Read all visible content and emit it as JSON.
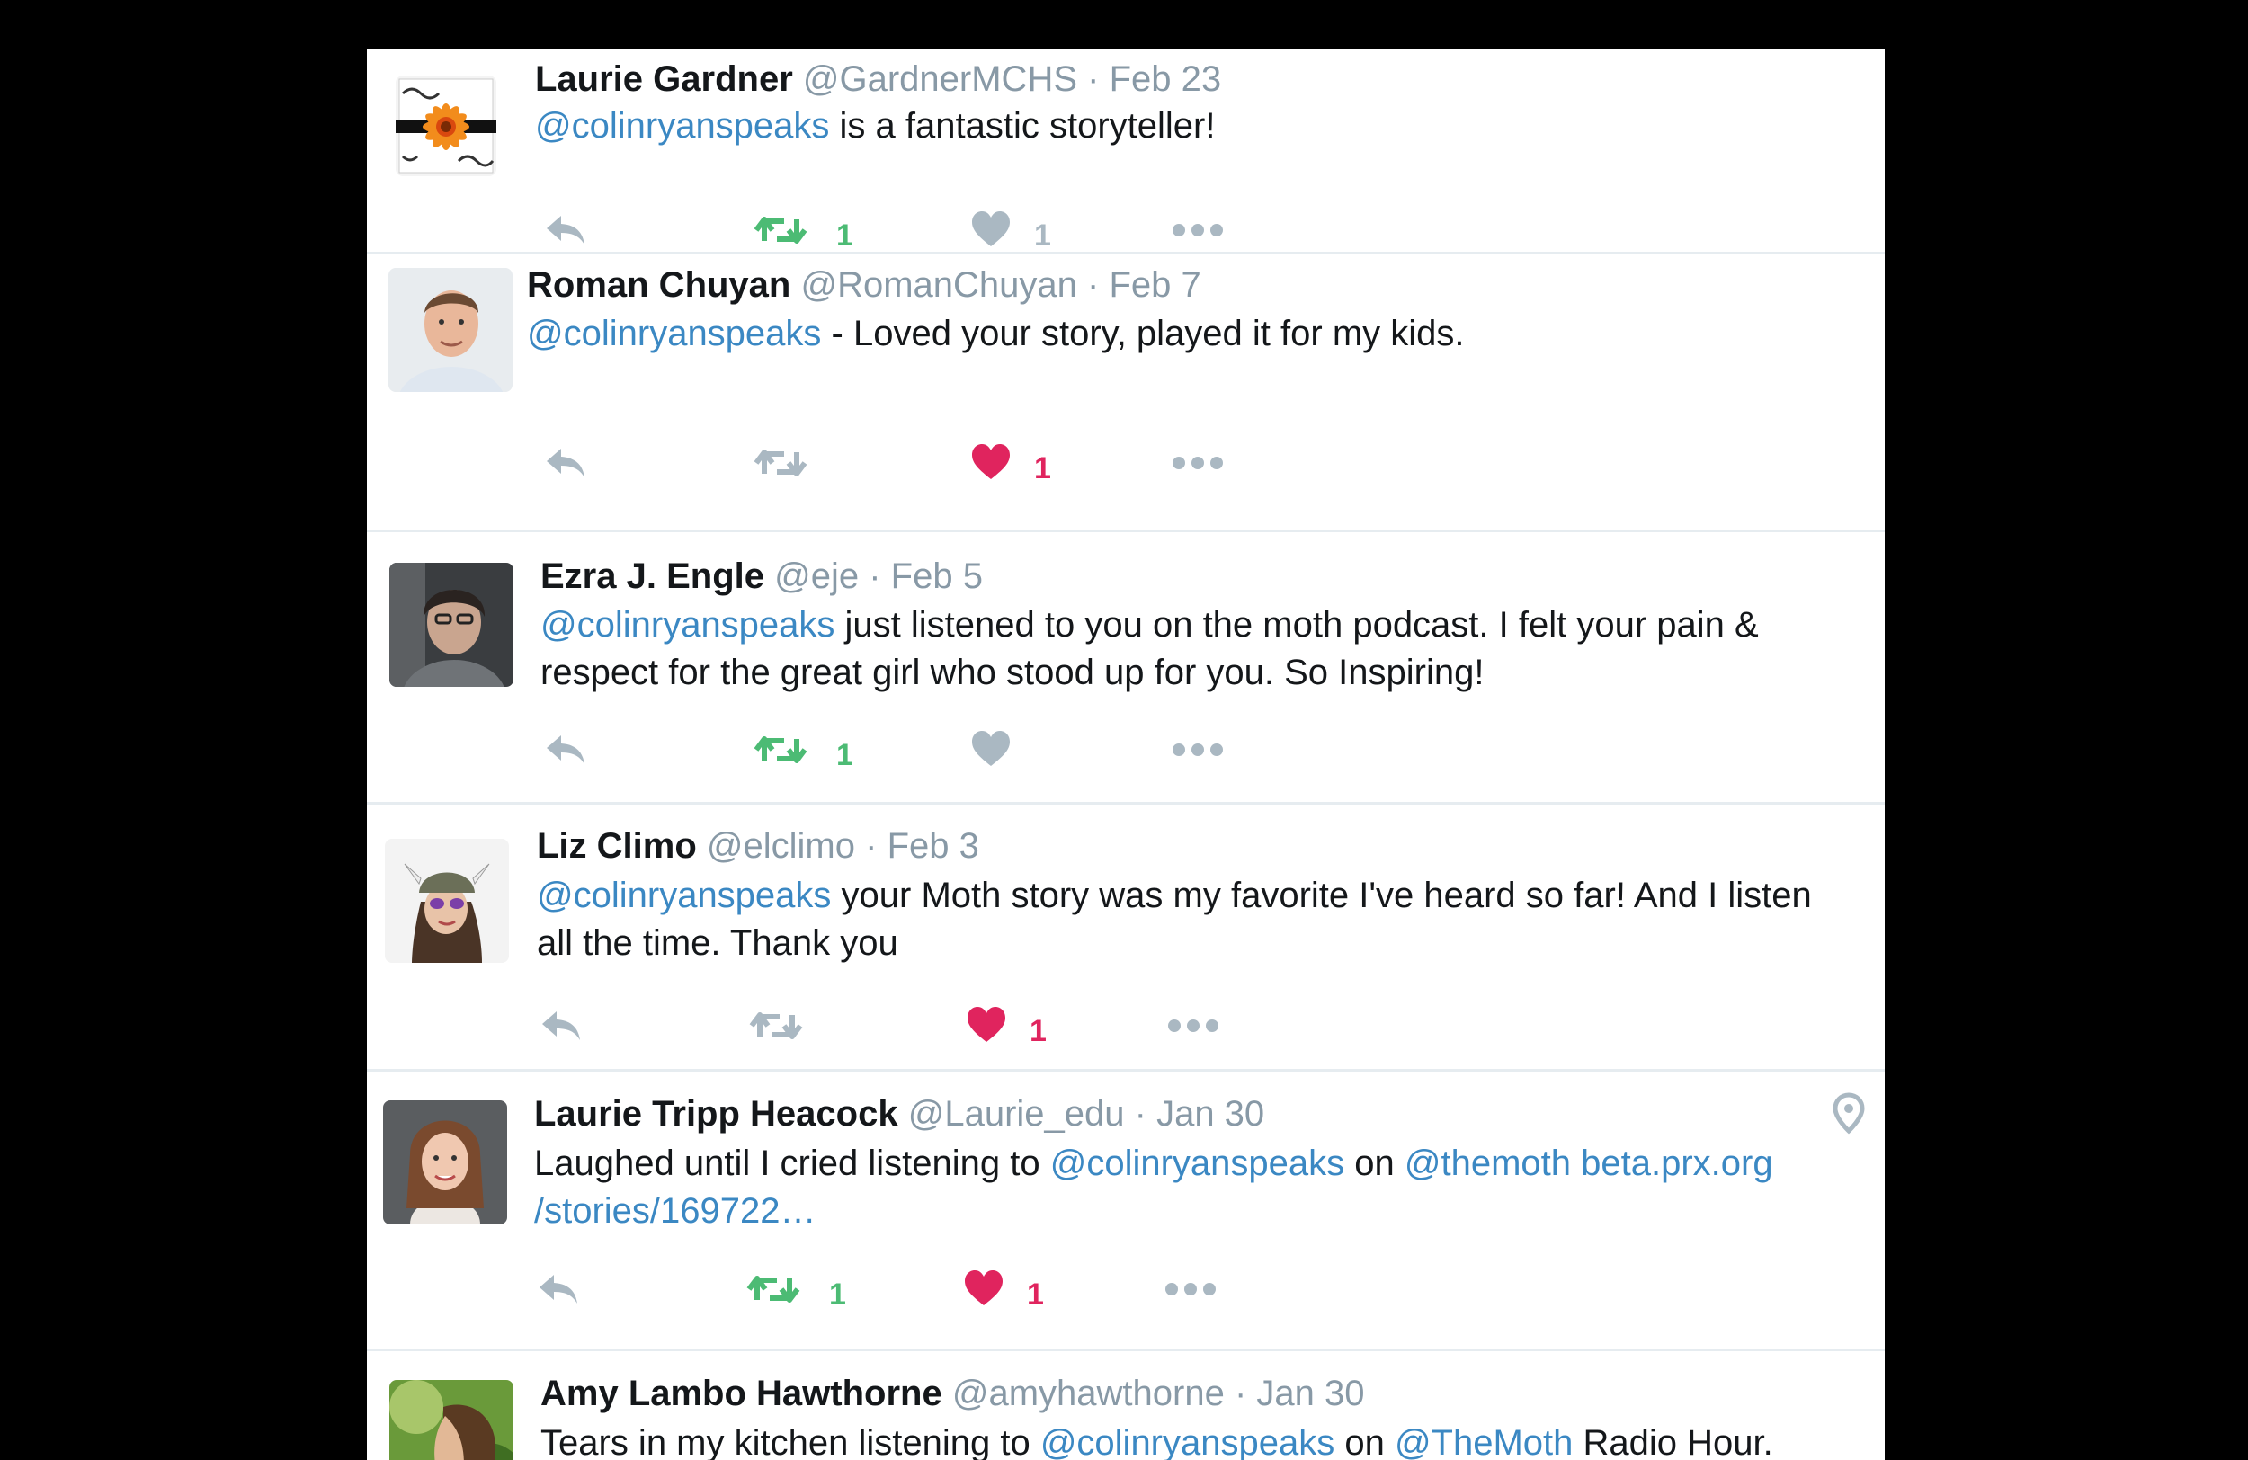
{
  "colors": {
    "link": "#3b88c3",
    "muted": "#aab8c2",
    "retweet_active": "#4cbb74",
    "like_active": "#e0245e"
  },
  "tweets": [
    {
      "name": "Laurie Gardner",
      "handle": "@GardnerMCHS",
      "sep": "·",
      "date": "Feb 23",
      "text": [
        {
          "type": "mention",
          "t": "@colinryanspeaks"
        },
        {
          "type": "text",
          "t": " is a fantastic storyteller!"
        }
      ],
      "text_line2": [],
      "retweets": "1",
      "retweeted": true,
      "likes": "1",
      "liked": false,
      "avatar_icon": "sunflower-avatar"
    },
    {
      "name": "Roman Chuyan",
      "handle": "@RomanChuyan",
      "sep": "·",
      "date": "Feb 7",
      "text": [
        {
          "type": "mention",
          "t": "@colinryanspeaks"
        },
        {
          "type": "text",
          "t": " - Loved your story, played it for my kids."
        }
      ],
      "text_line2": [],
      "retweets": "",
      "retweeted": false,
      "likes": "1",
      "liked": true,
      "avatar_icon": "man-avatar"
    },
    {
      "name": "Ezra J. Engle",
      "handle": "@eje",
      "sep": "·",
      "date": "Feb 5",
      "text": [
        {
          "type": "mention",
          "t": "@colinryanspeaks"
        },
        {
          "type": "text",
          "t": " just listened to you on the moth podcast. I felt your pain &"
        }
      ],
      "text_line2": [
        {
          "type": "text",
          "t": "respect for the great girl who stood up for you. So Inspiring!"
        }
      ],
      "retweets": "1",
      "retweeted": true,
      "likes": "",
      "liked": false,
      "avatar_icon": "man-avatar"
    },
    {
      "name": "Liz Climo",
      "handle": "@elclimo",
      "sep": "·",
      "date": "Feb 3",
      "text": [
        {
          "type": "mention",
          "t": "@colinryanspeaks"
        },
        {
          "type": "text",
          "t": " your Moth story was my favorite I've heard so far! And I listen"
        }
      ],
      "text_line2": [
        {
          "type": "text",
          "t": "all the time. Thank you"
        }
      ],
      "retweets": "",
      "retweeted": false,
      "likes": "1",
      "liked": true,
      "avatar_icon": "viking-helmet-avatar"
    },
    {
      "name": "Laurie Tripp Heacock",
      "handle": "@Laurie_edu",
      "sep": "·",
      "date": "Jan 30",
      "text": [
        {
          "type": "text",
          "t": "Laughed until I cried listening to "
        },
        {
          "type": "mention",
          "t": "@colinryanspeaks"
        },
        {
          "type": "text",
          "t": " on "
        },
        {
          "type": "mention",
          "t": "@themoth"
        },
        {
          "type": "text",
          "t": " "
        },
        {
          "type": "mention",
          "t": "beta.prx.org"
        }
      ],
      "text_line2": [
        {
          "type": "mention",
          "t": "/stories/169722…"
        }
      ],
      "retweets": "1",
      "retweeted": true,
      "likes": "1",
      "liked": true,
      "avatar_icon": "woman-avatar",
      "has_location": true
    },
    {
      "name": "Amy Lambo Hawthorne",
      "handle": "@amyhawthorne",
      "sep": "·",
      "date": "Jan 30",
      "text": [
        {
          "type": "text",
          "t": "Tears in my kitchen listening to "
        },
        {
          "type": "mention",
          "t": "@colinryanspeaks"
        },
        {
          "type": "text",
          "t": " on "
        },
        {
          "type": "mention",
          "t": "@TheMoth"
        },
        {
          "type": "text",
          "t": " Radio Hour."
        }
      ],
      "text_line2": [],
      "retweets": "",
      "retweeted": false,
      "likes": "",
      "liked": false,
      "avatar_icon": "woman-avatar"
    }
  ]
}
